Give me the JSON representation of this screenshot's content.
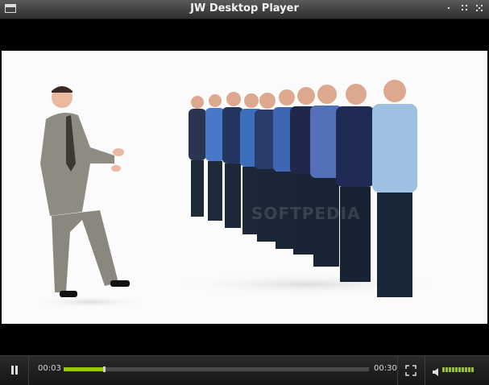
{
  "window": {
    "title": "JW Desktop Player"
  },
  "video": {
    "watermark": "SOFTPEDIA"
  },
  "controls": {
    "current_time": "00:03",
    "duration": "00:30",
    "progress_fraction": 0.13,
    "volume_fraction": 1.0,
    "accent_color": "#9cc31a"
  }
}
